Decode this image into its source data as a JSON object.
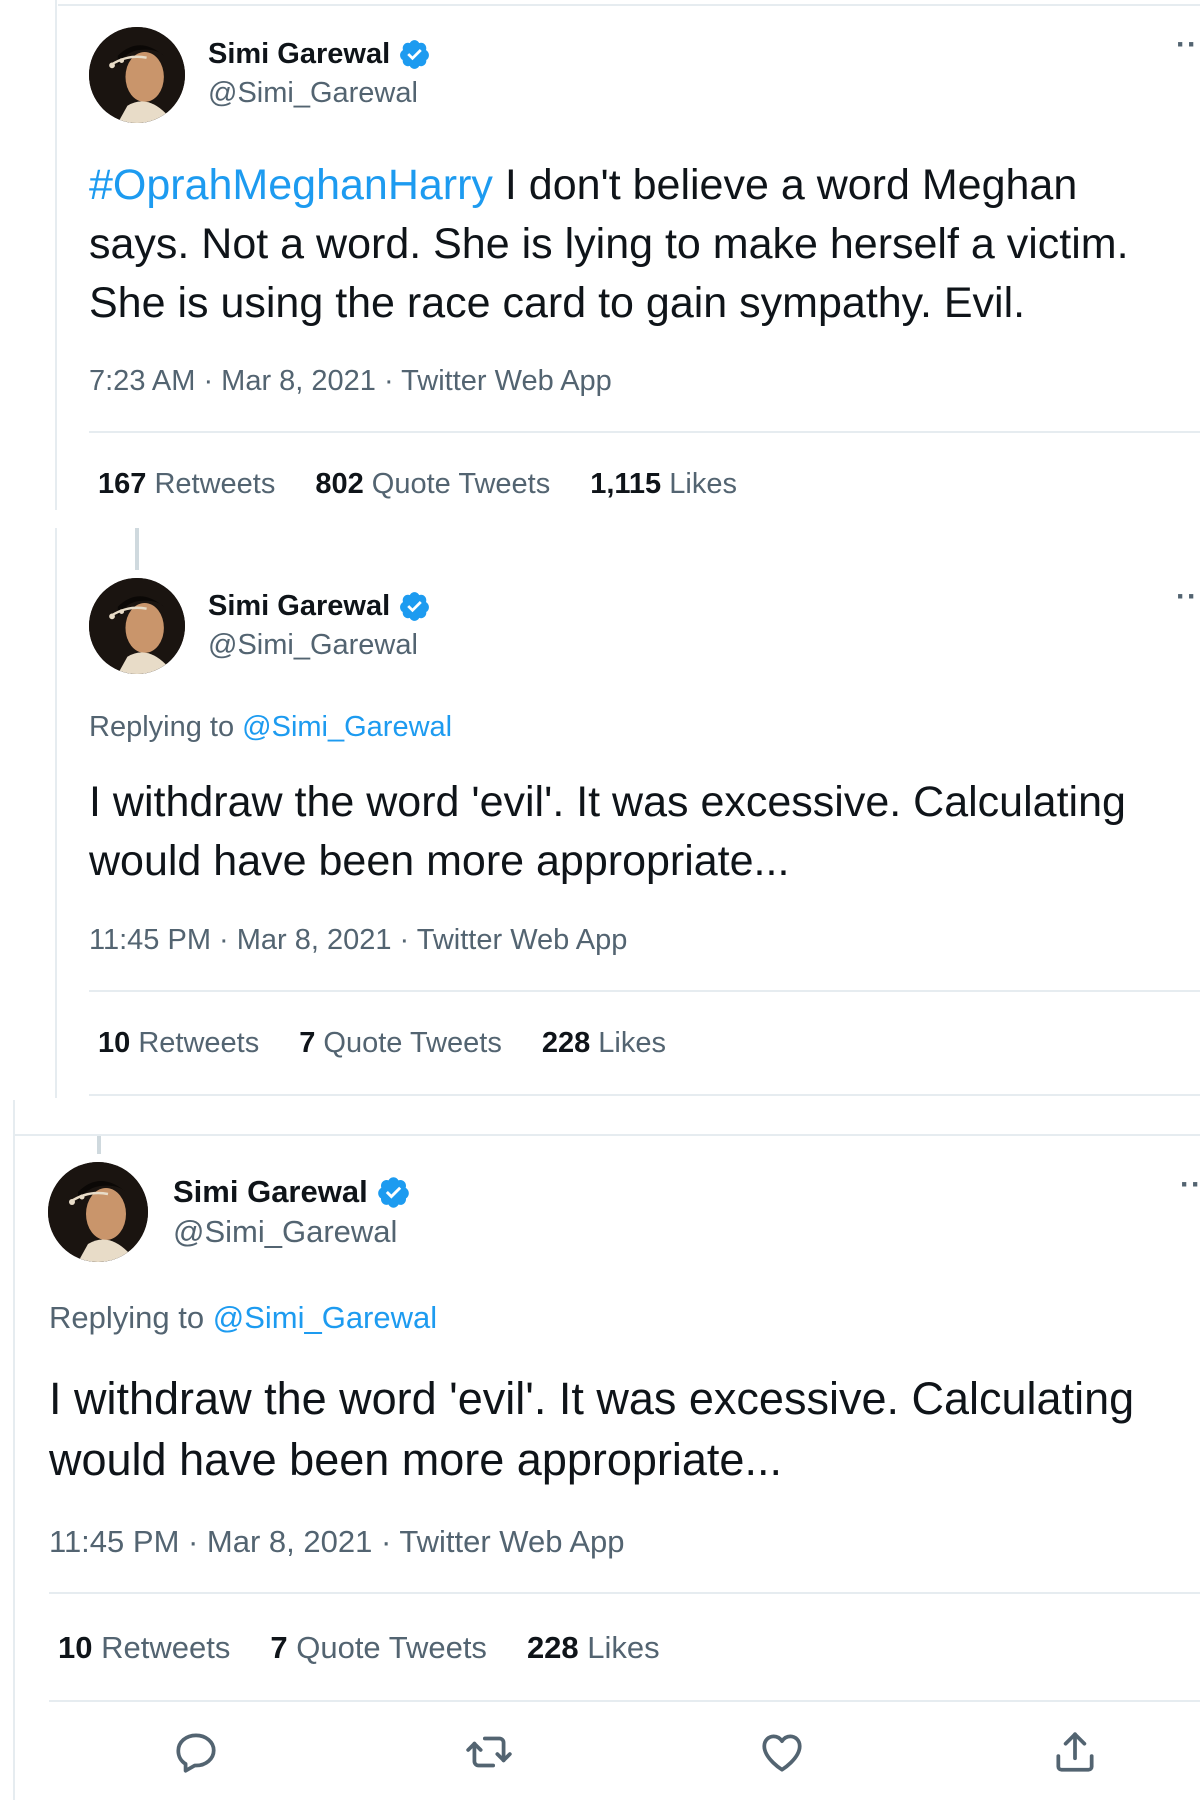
{
  "tweets": [
    {
      "author": {
        "name": "Simi Garewal",
        "handle": "@Simi_Garewal",
        "verified": true
      },
      "more": "··",
      "replying_label": "",
      "replying_handle": "",
      "hashtag": "#OprahMeghanHarry",
      "text": " I don't believe a word Meghan says. Not a word. She is lying to make herself a victim. She is using the race card to gain sympathy. Evil.",
      "meta": "7:23 AM · Mar 8, 2021 · Twitter Web App",
      "stats": {
        "retweets_count": "167",
        "retweets_label": "Retweets",
        "quotes_count": "802",
        "quotes_label": "Quote Tweets",
        "likes_count": "1,115",
        "likes_label": "Likes"
      }
    },
    {
      "author": {
        "name": "Simi Garewal",
        "handle": "@Simi_Garewal",
        "verified": true
      },
      "more": "··",
      "replying_label": "Replying to ",
      "replying_handle": "@Simi_Garewal",
      "text": "I withdraw the word 'evil'. It was excessive. Calculating would have been more appropriate...",
      "meta": "11:45 PM · Mar 8, 2021 · Twitter Web App",
      "stats": {
        "retweets_count": "10",
        "retweets_label": "Retweets",
        "quotes_count": "7",
        "quotes_label": "Quote Tweets",
        "likes_count": "228",
        "likes_label": "Likes"
      }
    },
    {
      "author": {
        "name": "Simi Garewal",
        "handle": "@Simi_Garewal",
        "verified": true
      },
      "more": "··",
      "replying_label": "Replying to ",
      "replying_handle": "@Simi_Garewal",
      "text": "I withdraw the word 'evil'. It was excessive. Calculating would have been more appropriate...",
      "meta": "11:45 PM · Mar 8, 2021 · Twitter Web App",
      "stats": {
        "retweets_count": "10",
        "retweets_label": "Retweets",
        "quotes_count": "7",
        "quotes_label": "Quote Tweets",
        "likes_count": "228",
        "likes_label": "Likes"
      },
      "actions": [
        "reply-icon",
        "retweet-icon",
        "like-icon",
        "share-icon"
      ]
    }
  ],
  "colors": {
    "accent": "#1d9bf0",
    "text": "#0f1419",
    "muted": "#536471",
    "border": "#e6ecf0"
  }
}
